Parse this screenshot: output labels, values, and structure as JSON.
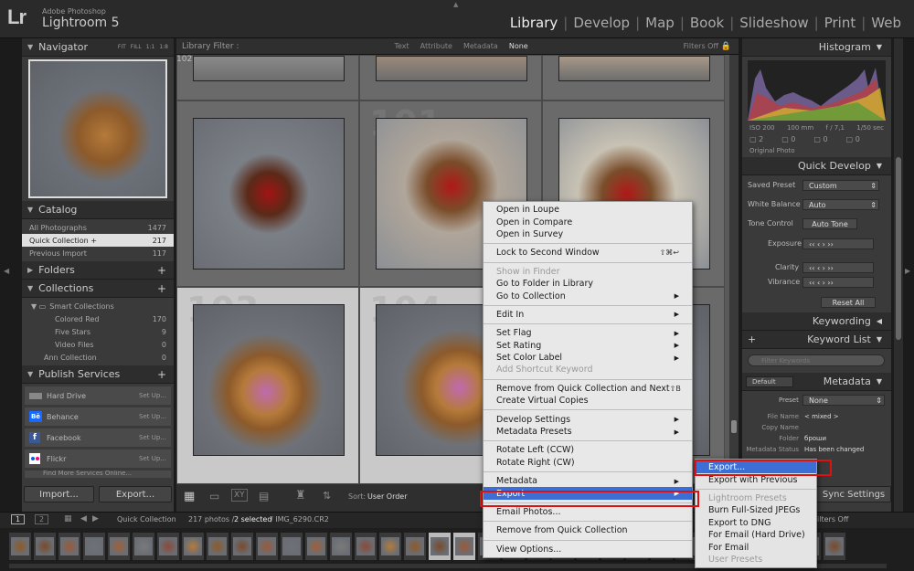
{
  "app": {
    "logo": "Lr",
    "brand_small": "Adobe Photoshop",
    "brand_name": "Lightroom 5"
  },
  "modules": [
    "Library",
    "Develop",
    "Map",
    "Book",
    "Slideshow",
    "Print",
    "Web"
  ],
  "navigator": {
    "title": "Navigator",
    "zoom_opts": [
      "FIT",
      "FILL",
      "1:1",
      "1:8"
    ]
  },
  "library_filter": {
    "label": "Library Filter :",
    "opts": [
      "Text",
      "Attribute",
      "Metadata",
      "None"
    ],
    "filters": "Filters Off"
  },
  "catalog": {
    "title": "Catalog",
    "items": [
      {
        "label": "All Photographs",
        "count": "1477"
      },
      {
        "label": "Quick Collection +",
        "count": "217"
      },
      {
        "label": "Previous Import",
        "count": "117"
      }
    ]
  },
  "folders": {
    "title": "Folders"
  },
  "collections": {
    "title": "Collections",
    "items": [
      {
        "label": "Smart Collections",
        "count": ""
      },
      {
        "label": "Colored Red",
        "count": "170"
      },
      {
        "label": "Five Stars",
        "count": "9"
      },
      {
        "label": "Video Files",
        "count": "0"
      },
      {
        "label": "Ann Collection",
        "count": "0"
      }
    ]
  },
  "publish": {
    "title": "Publish Services",
    "items": [
      {
        "label": "Hard Drive",
        "action": "Set Up..."
      },
      {
        "label": "Behance",
        "action": "Set Up..."
      },
      {
        "label": "Facebook",
        "action": "Set Up..."
      },
      {
        "label": "Flickr",
        "action": "Set Up..."
      }
    ],
    "find_more": "Find More Services Online..."
  },
  "left_buttons": {
    "import": "Import...",
    "export": "Export..."
  },
  "histogram": {
    "title": "Histogram",
    "iso": "ISO 200",
    "focal": "100 mm",
    "aperture": "f / 7,1",
    "shutter": "1/50 sec",
    "original": "Original Photo"
  },
  "quick_develop": {
    "title": "Quick Develop",
    "saved_preset_label": "Saved Preset",
    "saved_preset": "Custom",
    "wb_label": "White Balance",
    "wb": "Auto",
    "tone_label": "Tone Control",
    "auto_tone": "Auto Tone",
    "rows": [
      "Exposure",
      "Clarity",
      "Vibrance"
    ],
    "reset": "Reset All"
  },
  "keywording": {
    "title": "Keywording"
  },
  "keyword_list": {
    "title": "Keyword List",
    "placeholder": "Filter Keywords"
  },
  "metadata": {
    "title": "Metadata",
    "default": "Default",
    "preset_label": "Preset",
    "preset": "None",
    "fields": [
      {
        "label": "File Name",
        "value": "< mixed >"
      },
      {
        "label": "Copy Name",
        "value": ""
      },
      {
        "label": "Folder",
        "value": "броши"
      },
      {
        "label": "Metadata Status",
        "value": "Has been changed"
      }
    ]
  },
  "sync": {
    "label": "Sync Settings"
  },
  "toolbar": {
    "sort_label": "Sort:",
    "sort_value": "User Order"
  },
  "filmstrip": {
    "pages": [
      "1",
      "2"
    ],
    "source": "Quick Collection",
    "info": "217 photos /",
    "selected": "2 selected",
    "file": "/ IMG_6290.CR2",
    "filters": "Filters Off"
  },
  "grid": {
    "indices": [
      "102",
      "103",
      "104"
    ]
  },
  "context_menu": {
    "items": [
      {
        "label": "Open in Loupe"
      },
      {
        "label": "Open in Compare"
      },
      {
        "label": "Open in Survey"
      },
      {
        "sep": true
      },
      {
        "label": "Lock to Second Window",
        "key": "⇧⌘↩"
      },
      {
        "sep": true
      },
      {
        "label": "Show in Finder",
        "dis": true
      },
      {
        "label": "Go to Folder in Library"
      },
      {
        "label": "Go to Collection",
        "sub": true
      },
      {
        "sep": true
      },
      {
        "label": "Edit In",
        "sub": true
      },
      {
        "sep": true
      },
      {
        "label": "Set Flag",
        "sub": true
      },
      {
        "label": "Set Rating",
        "sub": true
      },
      {
        "label": "Set Color Label",
        "sub": true
      },
      {
        "label": "Add Shortcut Keyword",
        "dis": true
      },
      {
        "sep": true
      },
      {
        "label": "Remove from Quick Collection and Next",
        "key": "⇧B"
      },
      {
        "label": "Create Virtual Copies"
      },
      {
        "sep": true
      },
      {
        "label": "Develop Settings",
        "sub": true
      },
      {
        "label": "Metadata Presets",
        "sub": true
      },
      {
        "sep": true
      },
      {
        "label": "Rotate Left (CCW)"
      },
      {
        "label": "Rotate Right (CW)"
      },
      {
        "sep": true
      },
      {
        "label": "Metadata",
        "sub": true
      },
      {
        "label": "Export",
        "sub": true,
        "sel": true
      },
      {
        "sep": true
      },
      {
        "label": "Email Photos..."
      },
      {
        "sep": true
      },
      {
        "label": "Remove from Quick Collection"
      },
      {
        "sep": true
      },
      {
        "label": "View Options..."
      }
    ]
  },
  "export_submenu": {
    "items": [
      {
        "label": "Export...",
        "sel": true
      },
      {
        "label": "Export with Previous"
      },
      {
        "sep": true
      },
      {
        "label": "Lightroom Presets",
        "dis": true
      },
      {
        "label": "Burn Full-Sized JPEGs"
      },
      {
        "label": "Export to DNG"
      },
      {
        "label": "For Email (Hard Drive)"
      },
      {
        "label": "For Email"
      },
      {
        "label": "User Presets",
        "dis": true
      }
    ]
  }
}
